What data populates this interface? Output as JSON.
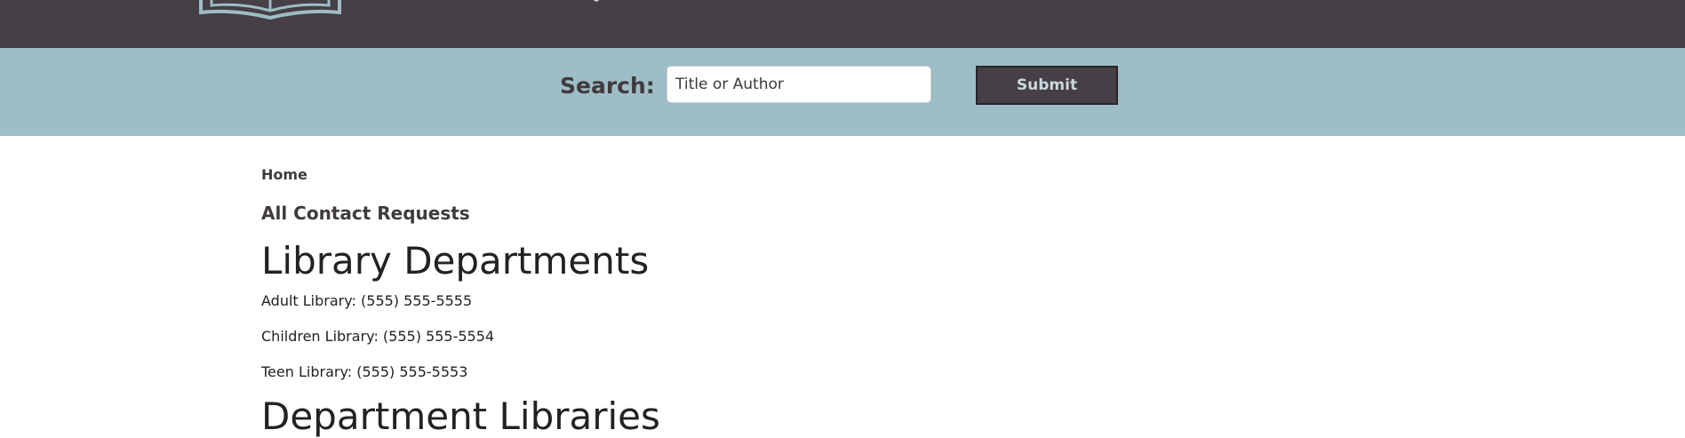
{
  "header": {
    "logo_icon": "open-book-icon"
  },
  "search": {
    "label": "Search:",
    "placeholder": "Title or Author",
    "value": "",
    "submit_label": "Submit"
  },
  "breadcrumb": {
    "home": "Home"
  },
  "links": {
    "contact_requests": "All Contact Requests"
  },
  "departments": {
    "heading": "Library Departments",
    "items": [
      {
        "text": "Adult Library: (555) 555-5555"
      },
      {
        "text": "Children Library: (555) 555-5554"
      },
      {
        "text": "Teen Library: (555) 555-5553"
      }
    ]
  },
  "next_section": {
    "heading": "Department Libraries"
  },
  "colors": {
    "header_bg": "#463f45",
    "search_bg": "#9dbdc7",
    "button_bg": "#463f45",
    "button_text": "#c9d9de",
    "text_dark": "#3f3a3e"
  }
}
